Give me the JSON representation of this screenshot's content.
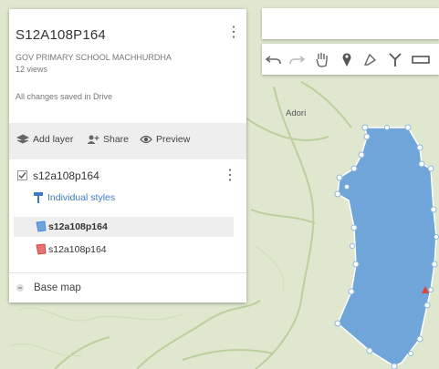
{
  "map": {
    "place_label": "Adori",
    "polygon_fill": "#6fa5d8",
    "polygon_stroke": "#ffffff",
    "background": "#dfe8cf",
    "road_color": "#b8cb9d"
  },
  "panel": {
    "title": "S12A108P164",
    "description": "GOV PRIMARY SCHOOL MACHHURDHA",
    "views": "12 views",
    "save_status": "All changes saved in Drive",
    "actions": {
      "add_layer": "Add layer",
      "share": "Share",
      "preview": "Preview"
    },
    "layer": {
      "name": "s12a108p164",
      "checked": true,
      "style_link": "Individual styles",
      "features": [
        {
          "label": "s12a108p164",
          "icon": "polygon-icon",
          "color": "#4a86e8",
          "selected": true
        },
        {
          "label": "s12a108p164",
          "icon": "polygon-icon",
          "color": "#db4437",
          "selected": false
        }
      ]
    },
    "base_map": "Base map"
  },
  "toolbar": {
    "tools": [
      "undo-icon",
      "redo-icon",
      "hand-icon",
      "marker-icon",
      "draw-line-icon",
      "directions-icon",
      "ruler-icon"
    ]
  }
}
